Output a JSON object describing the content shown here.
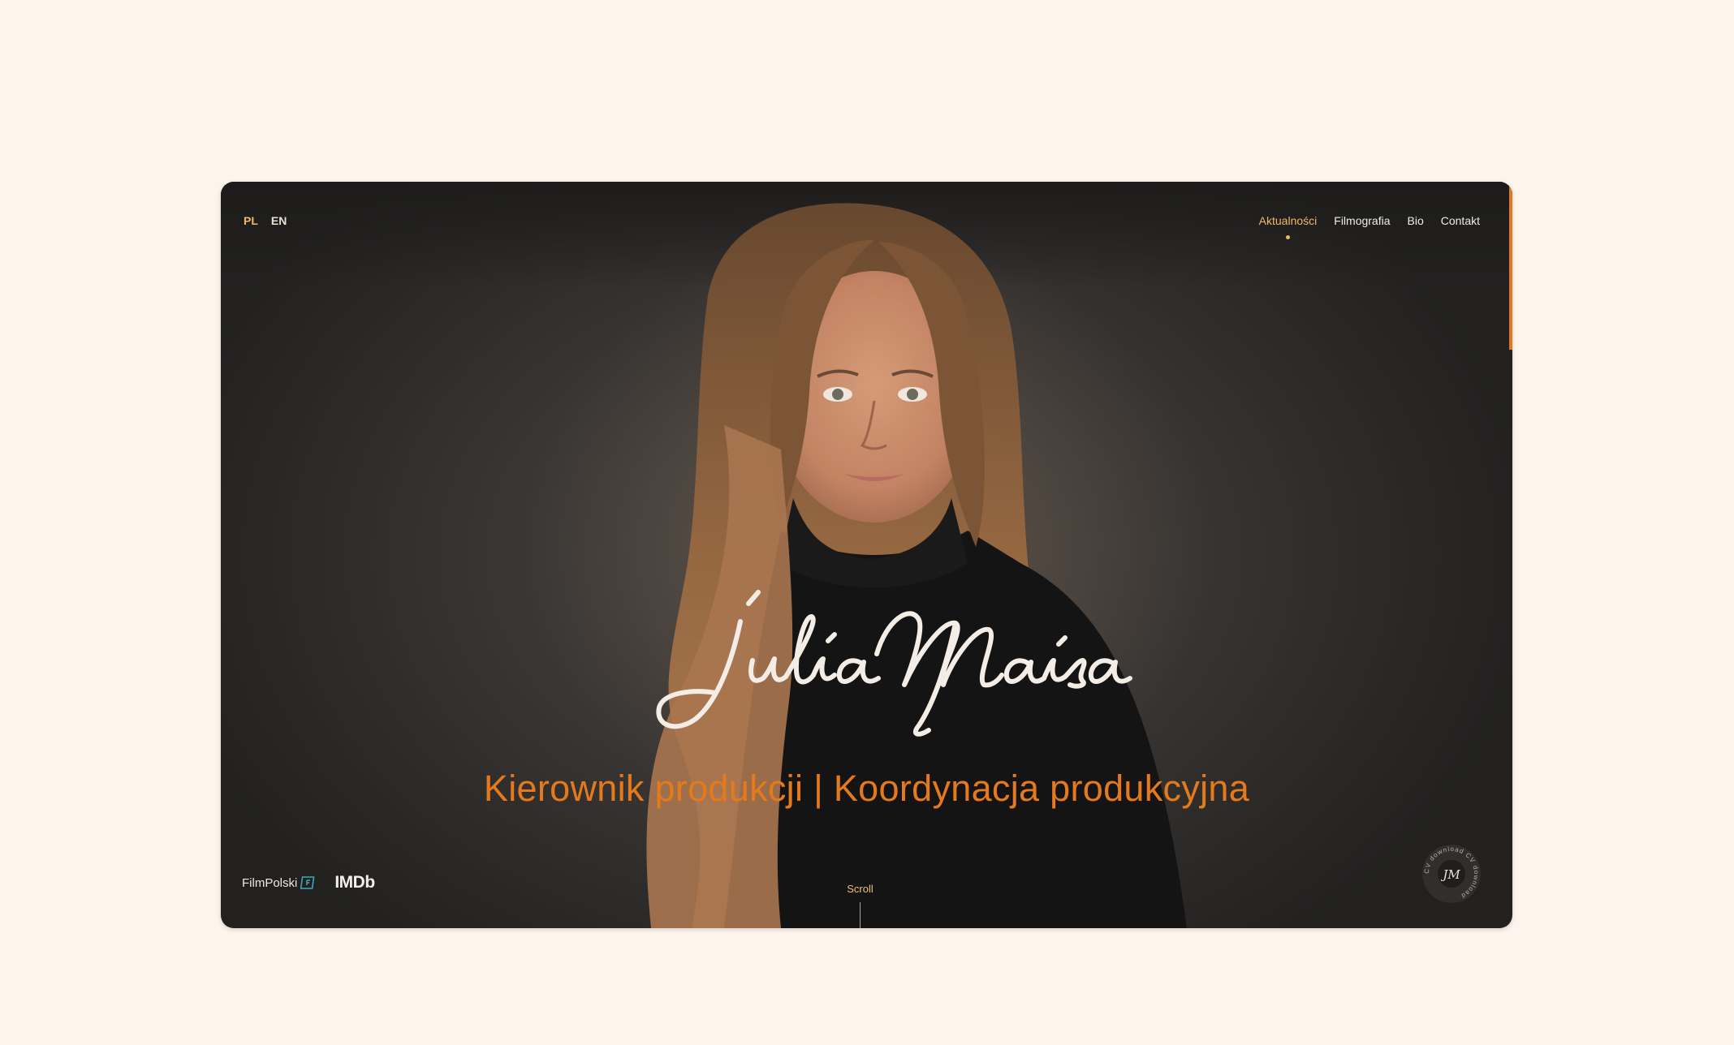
{
  "lang": {
    "pl": "PL",
    "en": "EN",
    "active": "PL"
  },
  "nav": {
    "items": [
      {
        "label": "Aktualności",
        "active": true
      },
      {
        "label": "Filmografia",
        "active": false
      },
      {
        "label": "Bio",
        "active": false
      },
      {
        "label": "Contakt",
        "active": false
      }
    ]
  },
  "hero": {
    "signature": "Júlia Maísa",
    "subtitle": "Kierownik produkcji | Koordynacja produkcyjna"
  },
  "footer": {
    "filmpolski": "FilmPolski",
    "imdb": "IMDb",
    "scroll": "Scroll",
    "cv_badge_text": "CV download CV download",
    "cv_monogram": "JM"
  },
  "colors": {
    "accent": "#e57a1d",
    "active_nav": "#f0b86a",
    "page_bg": "#fdf5ec"
  }
}
